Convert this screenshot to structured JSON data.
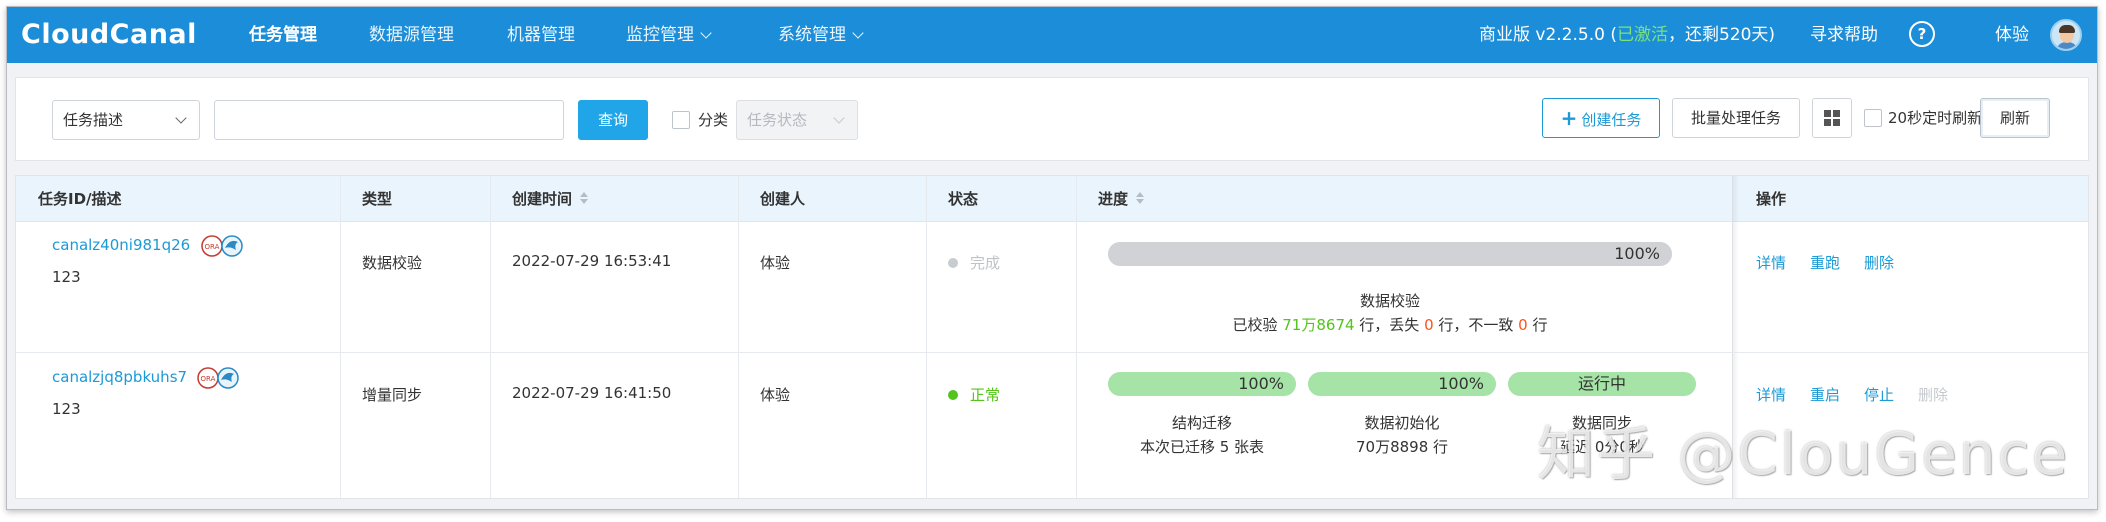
{
  "app": {
    "logo_text": "CloudCanal"
  },
  "nav": {
    "items": [
      {
        "label": "任务管理",
        "active": true
      },
      {
        "label": "数据源管理"
      },
      {
        "label": "机器管理"
      },
      {
        "label": "监控管理"
      },
      {
        "label": "系统管理"
      }
    ],
    "version": "商业版 v2.2.5.0 (",
    "activated": "已激活",
    "remaining": "，还剩520天)",
    "help_label": "寻求帮助",
    "help_icon": "?",
    "user": "体验"
  },
  "toolbar": {
    "filter_select": "任务描述",
    "search_value": "",
    "query_label": "查询",
    "category_label": "分类",
    "status_select": "任务状态",
    "create_label": "创建任务",
    "create_icon": "+",
    "batch_label": "批量处理任务",
    "auto_refresh_label": "20秒定时刷新",
    "refresh_label": "刷新"
  },
  "table": {
    "headers": {
      "id": "任务ID/描述",
      "type": "类型",
      "created": "创建时间",
      "creator": "创建人",
      "status": "状态",
      "progress": "进度",
      "actions": "操作"
    },
    "rows": [
      {
        "id": "canalz40ni981q26",
        "desc": "123",
        "type": "数据校验",
        "created": "2022-07-29 16:53:41",
        "creator": "体验",
        "status": "完成",
        "status_color": "#c8cbcf",
        "progress": {
          "pct": "100%",
          "fraction": 1.0,
          "stage": "数据校验",
          "line_a": "已校验 ",
          "verified": "71万8674",
          "line_b": " 行，丢失 ",
          "lost": "0",
          "line_c": " 行，不一致 ",
          "mismatch": "0",
          "line_d": " 行"
        },
        "actions": [
          "详情",
          "重跑",
          "删除"
        ]
      },
      {
        "id": "canalzjq8pbkuhs7",
        "desc": "123",
        "type": "增量同步",
        "created": "2022-07-29 16:41:50",
        "creator": "体验",
        "status": "正常",
        "status_color": "#52c41a",
        "progress": {
          "stages": [
            {
              "pct": "100%",
              "fraction": 1.0,
              "name": "结构迁移",
              "detail": "本次已迁移 5 张表"
            },
            {
              "pct": "100%",
              "fraction": 1.0,
              "name": "数据初始化",
              "detail": "70万8898 行"
            },
            {
              "pct": "运行中",
              "fraction": 1.0,
              "name": "数据同步",
              "detail": "延迟 0分0秒"
            }
          ]
        },
        "actions": [
          "详情",
          "重启",
          "停止",
          "删除"
        ]
      }
    ]
  },
  "watermark": "知乎 @ClouGence",
  "colors": {
    "nav": "#1c8dd8",
    "accent": "#20a6e8",
    "progress_green": "#a6e3a6"
  }
}
